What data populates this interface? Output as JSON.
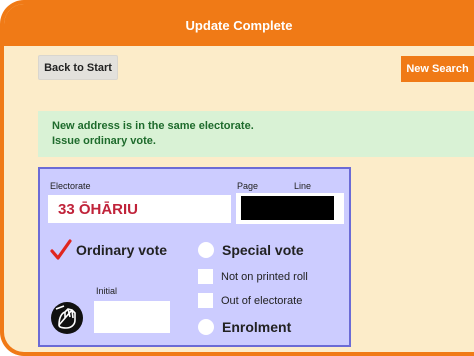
{
  "header": {
    "title": "Update Complete"
  },
  "toolbar": {
    "back_label": "Back to Start",
    "new_search_label": "New Search"
  },
  "notice": {
    "line1": "New address is in the same electorate.",
    "line2": "Issue ordinary vote."
  },
  "card": {
    "electorate_label": "Electorate",
    "electorate_value": "33 ŌHĀRIU",
    "page_label": "Page",
    "line_label": "Line",
    "ordinary_vote_label": "Ordinary vote",
    "special_vote_label": "Special vote",
    "not_on_printed_roll_label": "Not on printed roll",
    "out_of_electorate_label": "Out of electorate",
    "enrolment_label": "Enrolment",
    "initial_label": "Initial",
    "initial_value": ""
  },
  "colors": {
    "accent": "#f07a16",
    "background": "#fcecc9",
    "notice_bg": "#d9f2d5",
    "card_bg": "#ccccff",
    "electorate_text": "#c0233a"
  },
  "icons": {
    "ordinary_check": "check-icon",
    "signature": "hand-sign-icon"
  }
}
